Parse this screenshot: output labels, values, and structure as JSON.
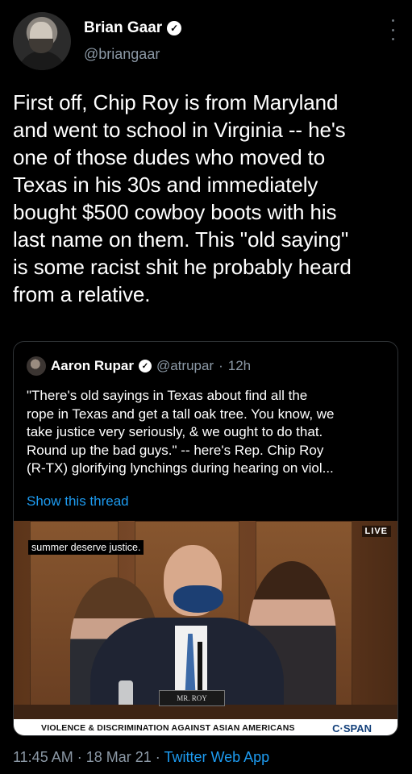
{
  "author": {
    "name": "Brian Gaar",
    "handle": "@briangaar",
    "verified_icon": "verified-badge-icon"
  },
  "tweet": {
    "text": "First off, Chip Roy is from Maryland\nand went to school in Virginia -- he's\none of those dudes who moved to\nTexas in his 30s and immediately\nbought $500 cowboy boots with his\nlast name on them. This \"old saying\"\nis some racist shit he probably heard\nfrom a relative."
  },
  "quoted_tweet": {
    "name": "Aaron Rupar",
    "handle": "@atrupar",
    "separator": "·",
    "time": "12h",
    "text": "\"There's old sayings in Texas about find all the\nrope in Texas and get a tall oak tree. You know, we\ntake justice very seriously, & we ought to do that.\nRound up the bad guys.\" -- here's Rep. Chip Roy\n(R-TX) glorifying lynchings during hearing on viol...",
    "show_thread": "Show this thread",
    "video": {
      "caption": "summer deserve justice.",
      "live_badge": "LIVE",
      "nameplate": "MR. ROY",
      "chyron": "VIOLENCE & DISCRIMINATION AGAINST ASIAN AMERICANS",
      "network": "C·SPAN"
    }
  },
  "footer": {
    "time": "11:45 AM",
    "sep1": " · ",
    "date": "18 Mar 21",
    "sep2": " · ",
    "app": "Twitter Web App"
  },
  "colors": {
    "background": "#000000",
    "secondary_text": "#8b98a5",
    "link": "#1d9bf0",
    "border": "#2f3336"
  }
}
